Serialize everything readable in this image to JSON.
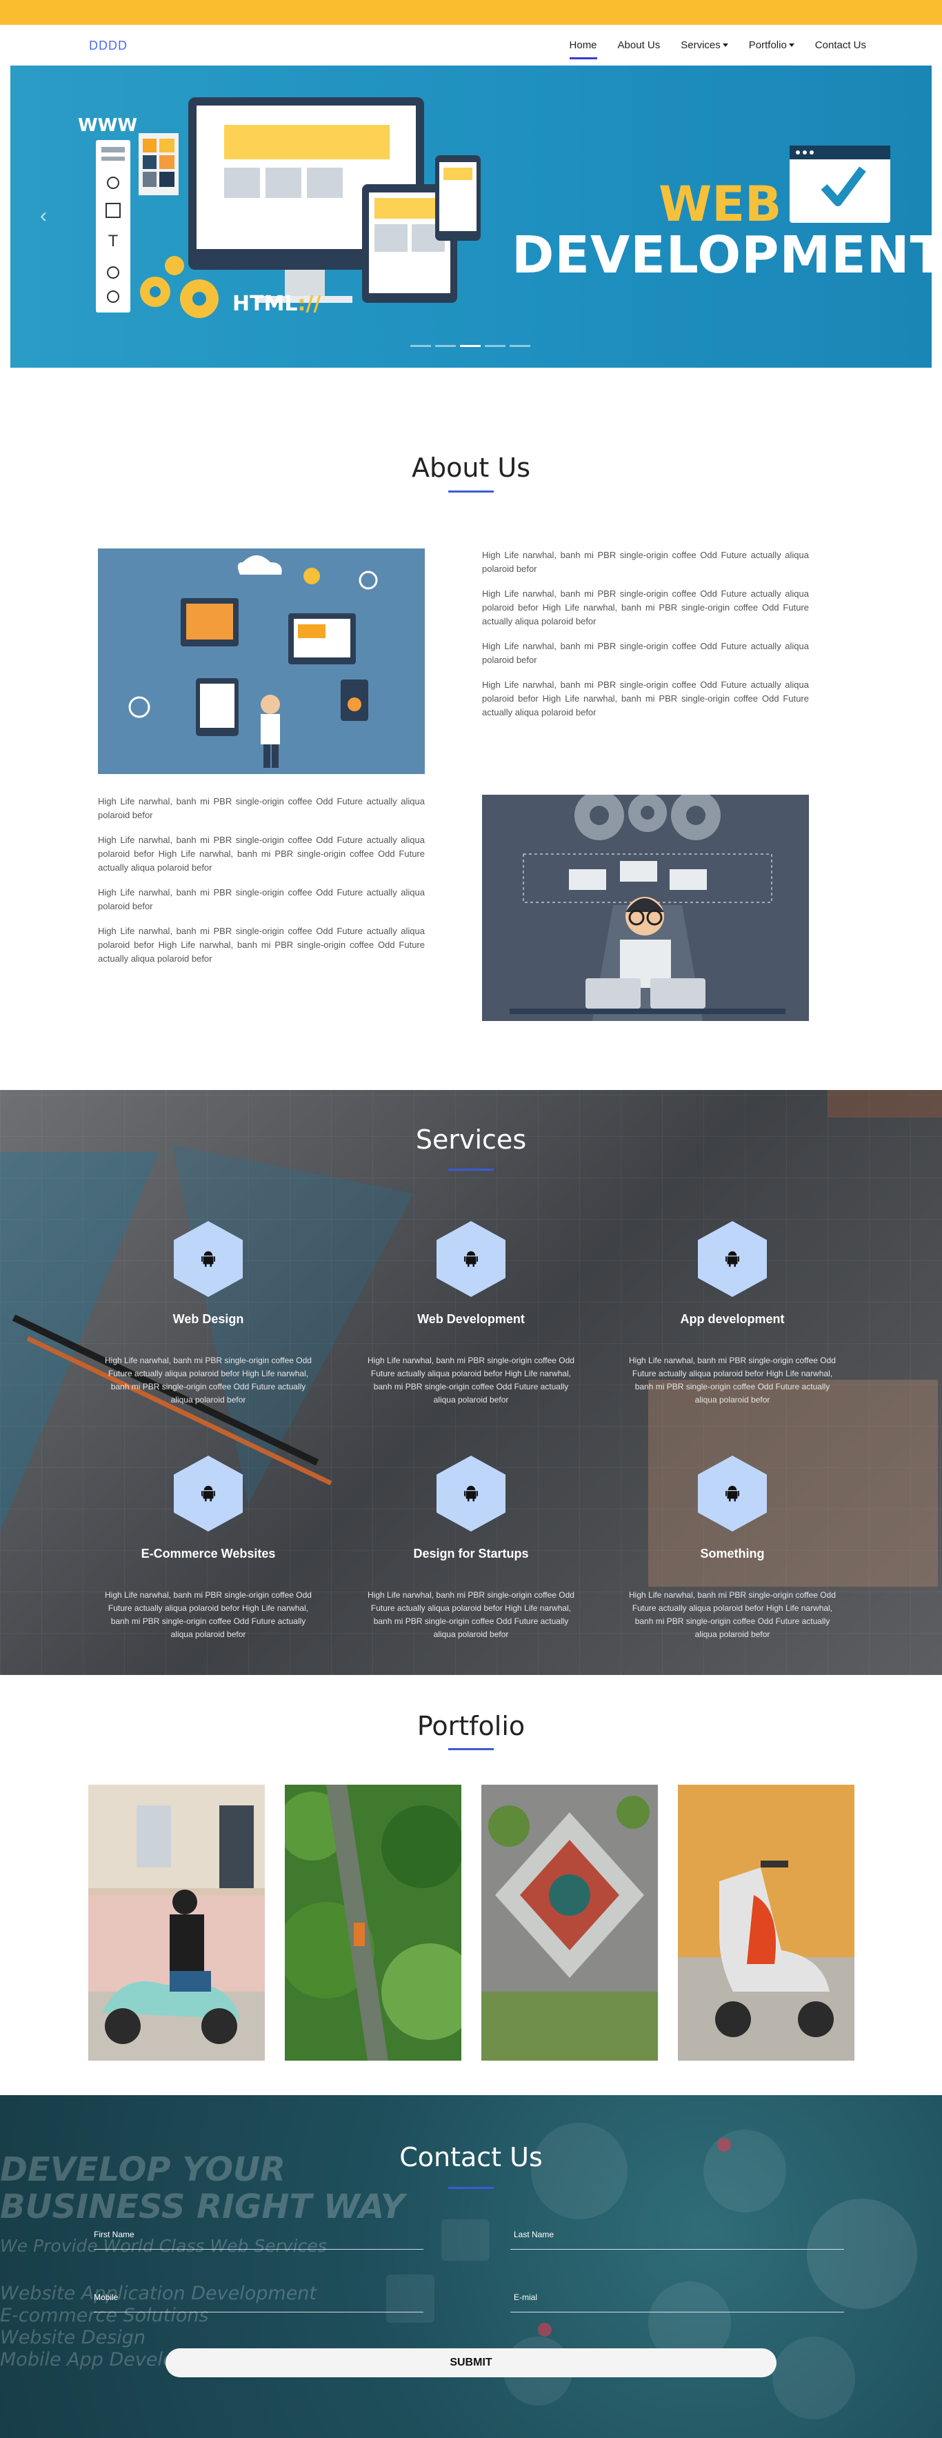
{
  "nav": {
    "brand": "DDDD",
    "items": [
      {
        "label": "Home",
        "active": true,
        "dropdown": false
      },
      {
        "label": "About Us",
        "active": false,
        "dropdown": false
      },
      {
        "label": "Services",
        "active": false,
        "dropdown": true
      },
      {
        "label": "Portfolio",
        "active": false,
        "dropdown": true
      },
      {
        "label": "Contact Us",
        "active": false,
        "dropdown": false
      }
    ]
  },
  "hero": {
    "www": "WWW",
    "title_line1": "WEB",
    "title_line2": "DEVELOPMENT",
    "html_label": "HTML",
    "html_slash": "://",
    "slides": 5,
    "active_slide": 3
  },
  "about": {
    "title": "About Us",
    "paragraph_a": "High Life narwhal, banh mi PBR single-origin coffee Odd Future actually aliqua polaroid befor",
    "paragraph_b": "High Life narwhal, banh mi PBR single-origin coffee Odd Future actually aliqua polaroid befor High Life narwhal, banh mi PBR single-origin coffee Odd Future actually aliqua polaroid befor"
  },
  "services": {
    "title": "Services",
    "description": "High Life narwhal, banh mi PBR single-origin coffee Odd Future actually aliqua polaroid befor High Life narwhal, banh mi PBR single-origin coffee Odd Future actually aliqua polaroid befor",
    "items": [
      {
        "name": "Web Design",
        "icon": "android-icon"
      },
      {
        "name": "Web Development",
        "icon": "android-icon"
      },
      {
        "name": "App development",
        "icon": "android-icon"
      },
      {
        "name": "E-Commerce Websites",
        "icon": "android-icon"
      },
      {
        "name": "Design for Startups",
        "icon": "android-icon"
      },
      {
        "name": "Something",
        "icon": "android-icon"
      }
    ]
  },
  "portfolio": {
    "title": "Portfolio"
  },
  "contact": {
    "title": "Contact Us",
    "bg_lines": [
      "DEVELOP YOUR",
      "BUSINESS RIGHT WAY",
      "We Provide World Class Web Services",
      "Website Application Development",
      "E-commerce Solutions",
      "Website Design",
      "Mobile App Development"
    ],
    "first_name": "First Name",
    "last_name": "Last Name",
    "mobile": "Mobile",
    "email": "E-mial",
    "submit": "SUBMIT"
  },
  "colors": {
    "accent_bar": "#fbbd30",
    "brand": "#4a6cf7",
    "underline": "#3b5bd6",
    "hex": "#bfd6fb"
  }
}
